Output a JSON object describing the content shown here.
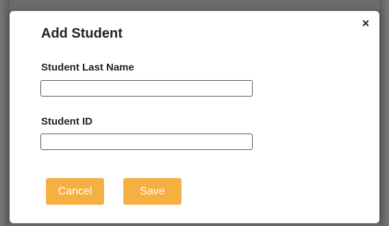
{
  "dialog": {
    "title": "Add Student",
    "close_label": "×",
    "fields": {
      "last_name": {
        "label": "Student Last Name",
        "value": "",
        "placeholder": ""
      },
      "student_id": {
        "label": "Student ID",
        "value": "",
        "placeholder": ""
      }
    },
    "buttons": {
      "cancel": "Cancel",
      "save": "Save"
    }
  },
  "colors": {
    "accent": "#f6b042",
    "overlay": "#6f6f6f",
    "dialog_bg": "#ffffff"
  }
}
